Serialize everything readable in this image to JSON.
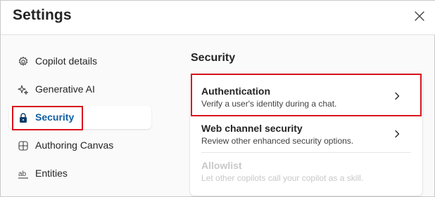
{
  "dialog": {
    "title": "Settings",
    "close_icon": "close-icon"
  },
  "sidebar": {
    "items": [
      {
        "label": "Copilot details",
        "icon": "gear-icon",
        "active": false
      },
      {
        "label": "Generative AI",
        "icon": "sparkle-icon",
        "active": false
      },
      {
        "label": "Security",
        "icon": "lock-icon",
        "active": true
      },
      {
        "label": "Authoring Canvas",
        "icon": "grid-icon",
        "active": false
      },
      {
        "label": "Entities",
        "icon": "entities-icon",
        "active": false
      }
    ]
  },
  "main": {
    "section_title": "Security",
    "options": [
      {
        "title": "Authentication",
        "description": "Verify a user's identity during a chat.",
        "enabled": true,
        "icon": "chevron-right-icon"
      },
      {
        "title": "Web channel security",
        "description": "Review other enhanced security options.",
        "enabled": true,
        "icon": "chevron-right-icon"
      },
      {
        "title": "Allowlist",
        "description": "Let other copilots call your copilot as a skill.",
        "enabled": false
      }
    ]
  },
  "colors": {
    "accent": "#115ea3",
    "highlight": "#d9141b",
    "disabled_text": "#c8c8c8"
  }
}
